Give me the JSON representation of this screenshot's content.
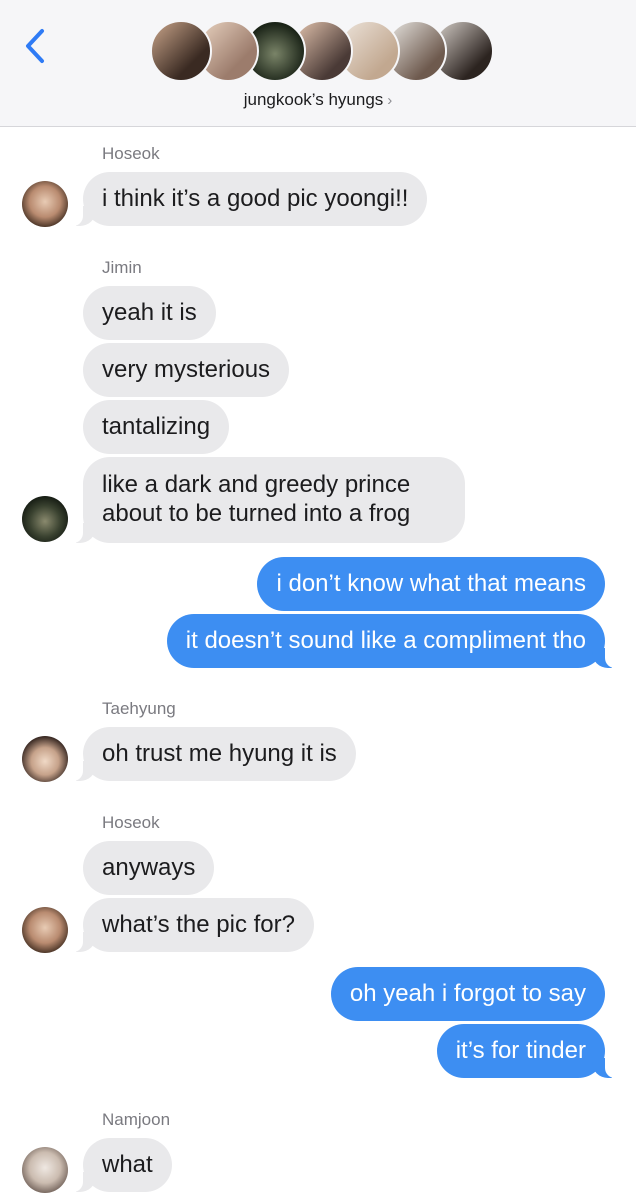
{
  "header": {
    "back_icon": "chevron-left-icon",
    "group_name": "jungkook’s hyungs",
    "chevron": "›",
    "avatar_count": 7
  },
  "messages": [
    {
      "type": "sender",
      "text": "Hoseok"
    },
    {
      "type": "in",
      "text": "i think it’s a good pic yoongi!!"
    },
    {
      "type": "sender",
      "text": "Jimin"
    },
    {
      "type": "in",
      "text": "yeah it is"
    },
    {
      "type": "in",
      "text": "very mysterious"
    },
    {
      "type": "in",
      "text": "tantalizing"
    },
    {
      "type": "in",
      "text": "like a dark and greedy prince about to be turned into a frog"
    },
    {
      "type": "out",
      "text": "i don’t know what that means"
    },
    {
      "type": "out",
      "text": "it doesn’t sound like a compliment tho"
    },
    {
      "type": "sender",
      "text": "Taehyung"
    },
    {
      "type": "in",
      "text": "oh trust me hyung it is"
    },
    {
      "type": "sender",
      "text": "Hoseok"
    },
    {
      "type": "in",
      "text": "anyways"
    },
    {
      "type": "in",
      "text": "what’s the pic for?"
    },
    {
      "type": "out",
      "text": "oh yeah i forgot to say"
    },
    {
      "type": "out",
      "text": "it’s for tinder"
    },
    {
      "type": "sender",
      "text": "Namjoon"
    },
    {
      "type": "in",
      "text": "what"
    }
  ],
  "colors": {
    "incoming_bubble": "#e9e9eb",
    "outgoing_bubble": "#3d8ef2",
    "ios_blue": "#2f7bf5"
  }
}
